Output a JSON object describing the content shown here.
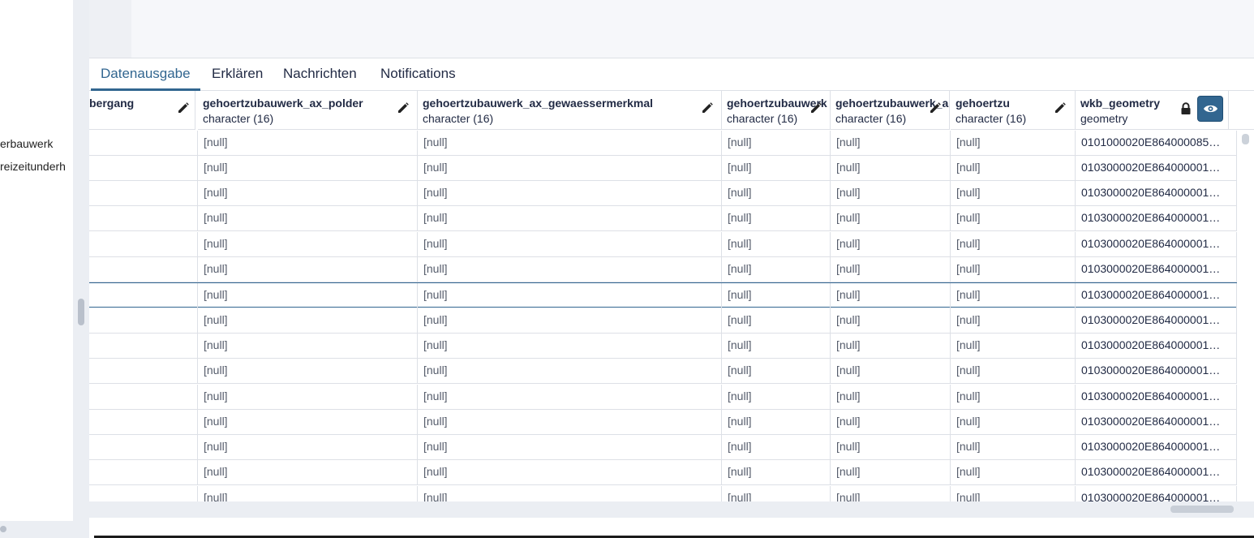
{
  "tree": {
    "items": [
      "erbauwerk",
      "reizeitunderh"
    ]
  },
  "tabs": [
    {
      "label": "Datenausgabe",
      "active": true
    },
    {
      "label": "Erklären",
      "active": false
    },
    {
      "label": "Nachrichten",
      "active": false
    },
    {
      "label": "Notifications",
      "active": false
    }
  ],
  "columns": [
    {
      "name": "bergang",
      "type": "",
      "icon": "pencil-icon"
    },
    {
      "name": "gehoertzubauwerk_ax_polder",
      "type": "character (16)",
      "icon": "pencil-icon"
    },
    {
      "name": "gehoertzubauwerk_ax_gewaessermerkmal",
      "type": "character (16)",
      "icon": "pencil-icon"
    },
    {
      "name": "gehoertzubauwerk",
      "type": "character (16)",
      "icon": "pencil-icon"
    },
    {
      "name": "gehoertzubauwerk_a",
      "type": "character (16)",
      "icon": "pencil-icon"
    },
    {
      "name": "gehoertzu",
      "type": "character (16)",
      "icon": "pencil-icon"
    },
    {
      "name": "wkb_geometry",
      "type": "geometry",
      "icon": "lock-icon",
      "button": "eye-icon"
    }
  ],
  "null_label": "[null]",
  "rows": [
    {
      "geometry": "0101000020E864000085…"
    },
    {
      "geometry": "0103000020E864000001…"
    },
    {
      "geometry": "0103000020E864000001…"
    },
    {
      "geometry": "0103000020E864000001…"
    },
    {
      "geometry": "0103000020E864000001…"
    },
    {
      "geometry": "0103000020E864000001…"
    },
    {
      "geometry": "0103000020E864000001…",
      "selected": true
    },
    {
      "geometry": "0103000020E864000001…"
    },
    {
      "geometry": "0103000020E864000001…"
    },
    {
      "geometry": "0103000020E864000001…"
    },
    {
      "geometry": "0103000020E864000001…"
    },
    {
      "geometry": "0103000020E864000001…"
    },
    {
      "geometry": "0103000020E864000001…"
    },
    {
      "geometry": "0103000020E864000001…"
    },
    {
      "geometry": "0103000020E864000001…"
    }
  ],
  "colors": {
    "accent": "#326690",
    "border": "#dde0e6",
    "text": "#222b45"
  }
}
